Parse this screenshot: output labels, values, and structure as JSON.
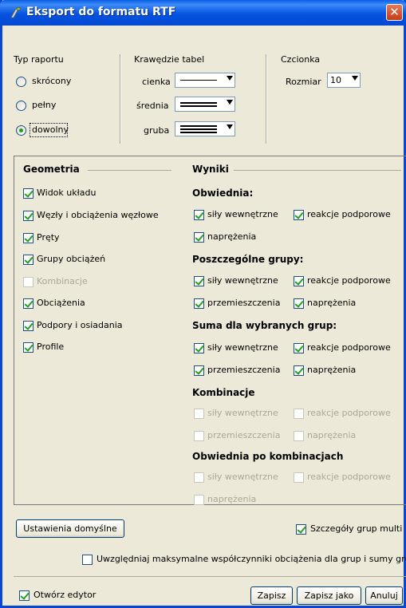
{
  "window": {
    "title": "Eksport do formatu RTF",
    "close": "✕"
  },
  "report_type": {
    "title": "Typ raportu",
    "options": [
      "skrócony",
      "pełny",
      "dowolny"
    ],
    "selected": "dowolny"
  },
  "table_borders": {
    "title": "Krawędzie tabel",
    "thin_label": "cienka",
    "medium_label": "średnia",
    "thick_label": "gruba"
  },
  "font": {
    "title": "Czcionka",
    "size_label": "Rozmiar",
    "size_value": "10"
  },
  "geometry": {
    "title": "Geometria",
    "items": [
      {
        "label": "Widok układu",
        "checked": true,
        "enabled": true
      },
      {
        "label": "Węzły i obciążenia węzłowe",
        "checked": true,
        "enabled": true
      },
      {
        "label": "Pręty",
        "checked": true,
        "enabled": true
      },
      {
        "label": "Grupy obciążeń",
        "checked": true,
        "enabled": true
      },
      {
        "label": "Kombinacje",
        "checked": false,
        "enabled": false
      },
      {
        "label": "Obciążenia",
        "checked": true,
        "enabled": true
      },
      {
        "label": "Podpory i osiadania",
        "checked": true,
        "enabled": true
      },
      {
        "label": "Profile",
        "checked": true,
        "enabled": true
      }
    ]
  },
  "results": {
    "title": "Wyniki",
    "groups": [
      {
        "title": "Obwiednia:",
        "items": [
          {
            "label": "siły wewnętrzne",
            "checked": true,
            "enabled": true
          },
          {
            "label": "reakcje podporowe",
            "checked": true,
            "enabled": true
          },
          {
            "label": "naprężenia",
            "checked": true,
            "enabled": true
          }
        ]
      },
      {
        "title": "Poszczególne grupy:",
        "items": [
          {
            "label": "siły wewnętrzne",
            "checked": true,
            "enabled": true
          },
          {
            "label": "reakcje podporowe",
            "checked": true,
            "enabled": true
          },
          {
            "label": "przemieszczenia",
            "checked": true,
            "enabled": true
          },
          {
            "label": "naprężenia",
            "checked": true,
            "enabled": true
          }
        ]
      },
      {
        "title": "Suma dla wybranych grup:",
        "items": [
          {
            "label": "siły wewnętrzne",
            "checked": true,
            "enabled": true
          },
          {
            "label": "reakcje podporowe",
            "checked": true,
            "enabled": true
          },
          {
            "label": "przemieszczenia",
            "checked": true,
            "enabled": true
          },
          {
            "label": "naprężenia",
            "checked": true,
            "enabled": true
          }
        ]
      },
      {
        "title": "Kombinacje",
        "items": [
          {
            "label": "siły wewnętrzne",
            "checked": false,
            "enabled": false
          },
          {
            "label": "reakcje podporowe",
            "checked": false,
            "enabled": false
          },
          {
            "label": "przemieszczenia",
            "checked": false,
            "enabled": false
          },
          {
            "label": "naprężenia",
            "checked": false,
            "enabled": false
          }
        ]
      },
      {
        "title": "Obwiednia po kombinacjach",
        "items": [
          {
            "label": "siły wewnętrzne",
            "checked": false,
            "enabled": false
          },
          {
            "label": "reakcje podporowe",
            "checked": false,
            "enabled": false
          },
          {
            "label": "naprężenia",
            "checked": false,
            "enabled": false
          }
        ]
      }
    ]
  },
  "bottom": {
    "defaults_button": "Ustawienia domyślne",
    "group_details_label": "Szczegóły grup multi",
    "group_details_checked": true,
    "max_factors_label": "Uwzględniaj maksymalne współczynniki obciążenia dla grup i sumy grup",
    "max_factors_checked": false,
    "open_editor_label": "Otwórz edytor",
    "open_editor_checked": true,
    "save_button": "Zapisz",
    "save_as_button": "Zapisz jako",
    "cancel_button": "Anuluj"
  },
  "colors": {
    "title_bar": "#0553e0",
    "close_button": "#c63a17",
    "dialog_bg": "#ece9d8",
    "check_mark": "#21a121"
  }
}
